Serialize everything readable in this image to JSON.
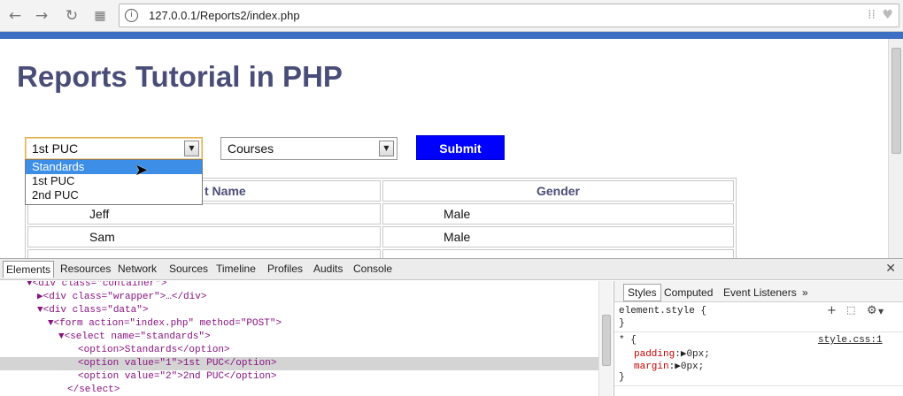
{
  "browser": {
    "url": "127.0.0.1/Reports2/index.php",
    "icons": [
      "back-icon",
      "forward-icon",
      "reload-icon",
      "apps-icon",
      "site-info-icon",
      "apps-grid-icon",
      "bookmark-heart-icon"
    ]
  },
  "page": {
    "title": "Reports Tutorial in PHP",
    "standards_select": {
      "value": "1st PUC",
      "options": [
        "Standards",
        "1st PUC",
        "2nd PUC"
      ],
      "highlighted": "Standards"
    },
    "courses_select": {
      "value": "Courses"
    },
    "submit_label": "Submit",
    "table": {
      "headers": [
        "Student Name",
        "Gender"
      ],
      "header_visible": "t Name",
      "rows": [
        [
          "Jeff",
          "Male"
        ],
        [
          "Sam",
          "Male"
        ]
      ]
    }
  },
  "devtools": {
    "tabs": [
      "Elements",
      "Resources",
      "Network",
      "Sources",
      "Timeline",
      "Profiles",
      "Audits",
      "Console"
    ],
    "active_tab": "Elements",
    "dom_lines": [
      "▼<div class=\"container\">",
      "▶<div class=\"wrapper\">…</div>",
      "▼<div class=\"data\">",
      "▼<form action=\"index.php\" method=\"POST\">",
      "▼<select name=\"standards\">",
      "<option>Standards</option>",
      "<option value=\"1\">1st PUC</option>",
      "<option value=\"2\">2nd PUC</option>",
      "</select>"
    ],
    "side_tabs": [
      "Styles",
      "Computed",
      "Event Listeners",
      "»"
    ],
    "active_side_tab": "Styles",
    "element_style": "element.style {",
    "close_brace": "}",
    "rule_selector": "* {",
    "rule_source": "style.css:1",
    "rule_props": [
      {
        "name": "padding",
        "value": "0px;"
      },
      {
        "name": "margin",
        "value": "0px;"
      }
    ]
  },
  "colors": {
    "title": "#4a4d78",
    "submit_bg": "#0000ff",
    "highlight": "#3d8ee7",
    "tab_strip": "#3c6ec4"
  }
}
